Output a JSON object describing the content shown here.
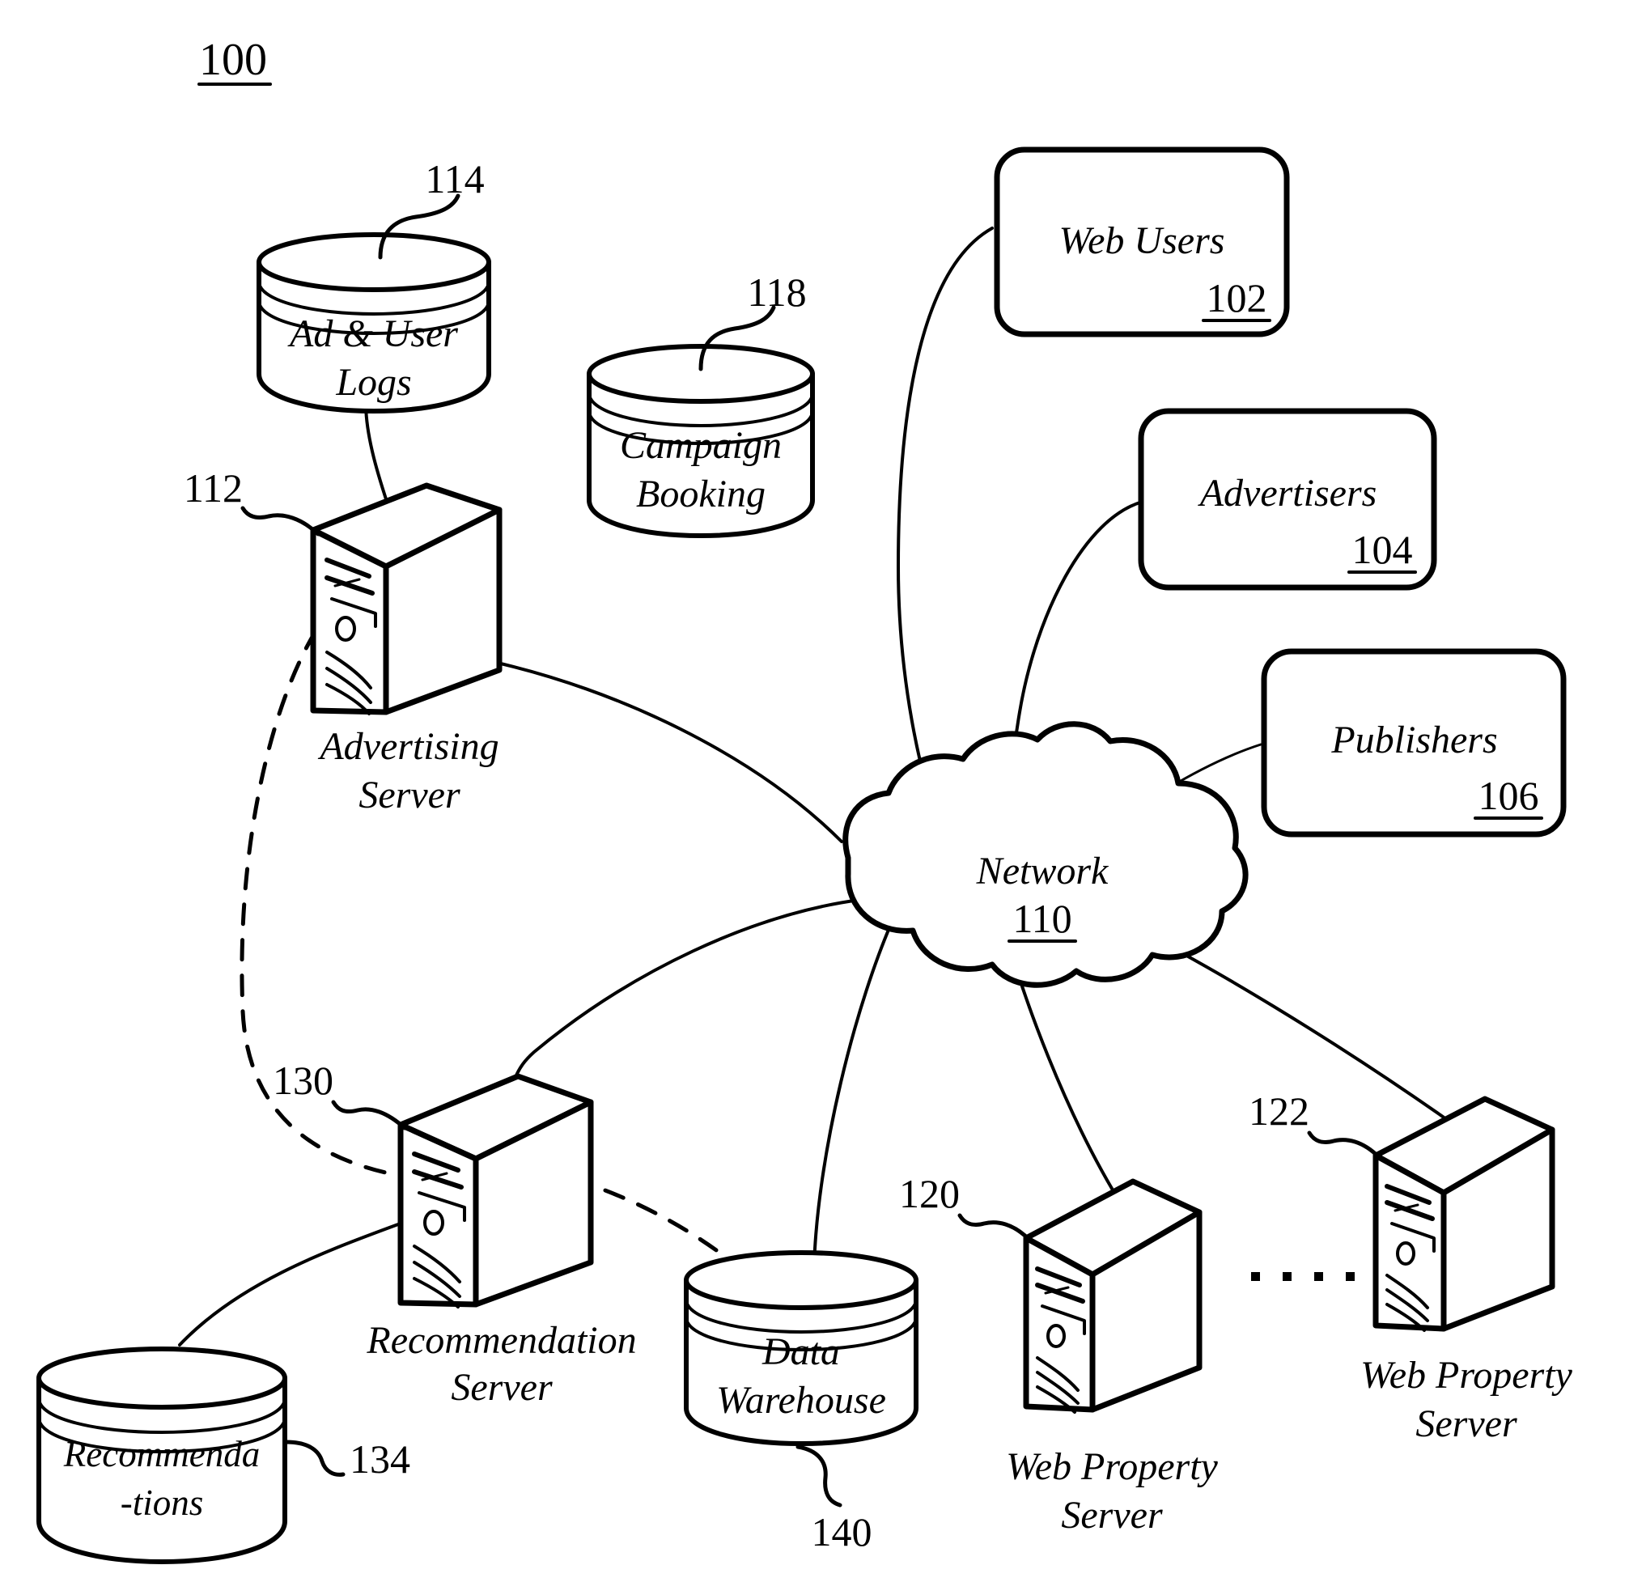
{
  "figure": {
    "number": "100",
    "underlined": true
  },
  "nodes": {
    "ad_user_logs": {
      "type": "database-cylinder",
      "label_line1": "Ad & User",
      "label_line2": "Logs",
      "ref": "114"
    },
    "campaign_booking": {
      "type": "database-cylinder",
      "label_line1": "Campaign",
      "label_line2": "Booking",
      "ref": "118"
    },
    "advertising_server": {
      "type": "server-tower",
      "label_line1": "Advertising",
      "label_line2": "Server",
      "ref": "112"
    },
    "recommendation_server": {
      "type": "server-tower",
      "label_line1": "Recommendation",
      "label_line2": "Server",
      "ref": "130"
    },
    "recommendations_db": {
      "type": "database-cylinder",
      "label_line1": "Recommenda",
      "label_line2": "-tions",
      "ref": "134"
    },
    "data_warehouse": {
      "type": "database-cylinder",
      "label_line1": "Data",
      "label_line2": "Warehouse",
      "ref": "140"
    },
    "web_property_server_1": {
      "type": "server-tower",
      "label_line1": "Web Property",
      "label_line2": "Server",
      "ref": "120"
    },
    "web_property_server_n": {
      "type": "server-tower",
      "label_line1": "Web Property",
      "label_line2": "Server",
      "ref": "122"
    },
    "web_users": {
      "type": "rounded-box",
      "label": "Web Users",
      "ref": "102"
    },
    "advertisers": {
      "type": "rounded-box",
      "label": "Advertisers",
      "ref": "104"
    },
    "publishers": {
      "type": "rounded-box",
      "label": "Publishers",
      "ref": "106"
    },
    "network": {
      "type": "cloud",
      "label": "Network",
      "ref": "110"
    }
  },
  "ellipsis": {
    "symbol": "▪ ▪ ▪ ▪ ▪",
    "between": "web_property_server_1 and web_property_server_n"
  },
  "colors": {
    "line": "#000000",
    "fill": "#ffffff"
  },
  "connections": [
    {
      "from": "ad_user_logs",
      "to": "advertising_server",
      "style": "solid"
    },
    {
      "from": "campaign_booking",
      "to": "advertising_server",
      "style": "solid"
    },
    {
      "from": "advertising_server",
      "to": "network",
      "style": "solid"
    },
    {
      "from": "advertising_server",
      "to": "recommendation_server",
      "style": "dashed"
    },
    {
      "from": "recommendation_server",
      "to": "network",
      "style": "solid"
    },
    {
      "from": "recommendation_server",
      "to": "recommendations_db",
      "style": "solid"
    },
    {
      "from": "recommendation_server",
      "to": "data_warehouse",
      "style": "dashed"
    },
    {
      "from": "data_warehouse",
      "to": "network",
      "style": "solid"
    },
    {
      "from": "web_users",
      "to": "network",
      "style": "solid"
    },
    {
      "from": "advertisers",
      "to": "network",
      "style": "solid"
    },
    {
      "from": "publishers",
      "to": "network",
      "style": "solid"
    },
    {
      "from": "web_property_server_1",
      "to": "network",
      "style": "solid"
    },
    {
      "from": "web_property_server_n",
      "to": "network",
      "style": "solid"
    }
  ]
}
